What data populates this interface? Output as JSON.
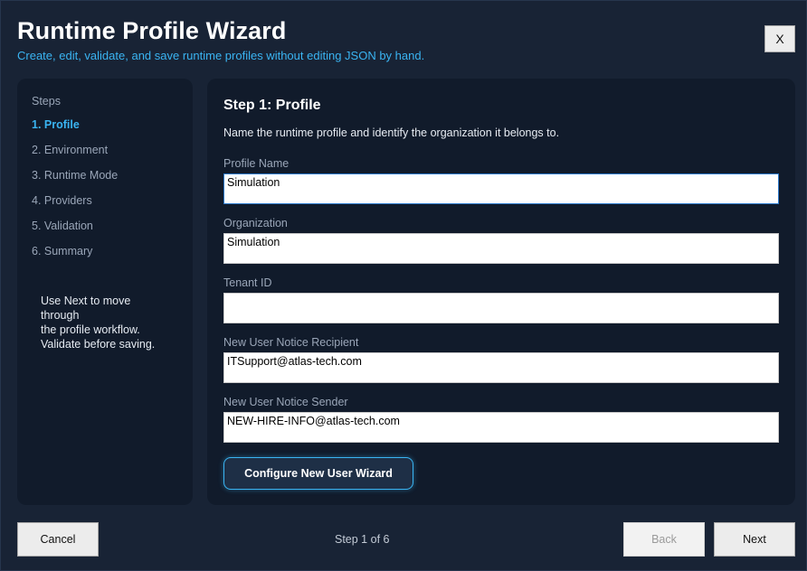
{
  "window": {
    "title": "Runtime Profile Wizard",
    "subtitle": "Create, edit, validate, and save runtime profiles without editing JSON by hand.",
    "close_label": "X"
  },
  "steps": {
    "heading": "Steps",
    "items": [
      {
        "label": "1. Profile",
        "active": true
      },
      {
        "label": "2. Environment",
        "active": false
      },
      {
        "label": "3. Runtime Mode",
        "active": false
      },
      {
        "label": "4. Providers",
        "active": false
      },
      {
        "label": "5. Validation",
        "active": false
      },
      {
        "label": "6. Summary",
        "active": false
      }
    ],
    "help_lines": [
      "Use Next to move through",
      "the profile workflow.",
      "Validate before saving."
    ]
  },
  "main": {
    "title": "Step 1: Profile",
    "description": "Name the runtime profile and identify the organization it belongs to.",
    "fields": [
      {
        "label": "Profile Name",
        "value": "Simulation"
      },
      {
        "label": "Organization",
        "value": "Simulation"
      },
      {
        "label": "Tenant ID",
        "value": ""
      },
      {
        "label": "New User Notice Recipient",
        "value": "ITSupport@atlas-tech.com"
      },
      {
        "label": "New User Notice Sender",
        "value": "NEW-HIRE-INFO@atlas-tech.com"
      }
    ],
    "configure_button": "Configure New User Wizard"
  },
  "footer": {
    "cancel_label": "Cancel",
    "step_indicator": "Step 1 of 6",
    "back_label": "Back",
    "next_label": "Next"
  },
  "colors": {
    "background": "#182335",
    "panel": "#111b2b",
    "accent": "#3ab4f2"
  }
}
